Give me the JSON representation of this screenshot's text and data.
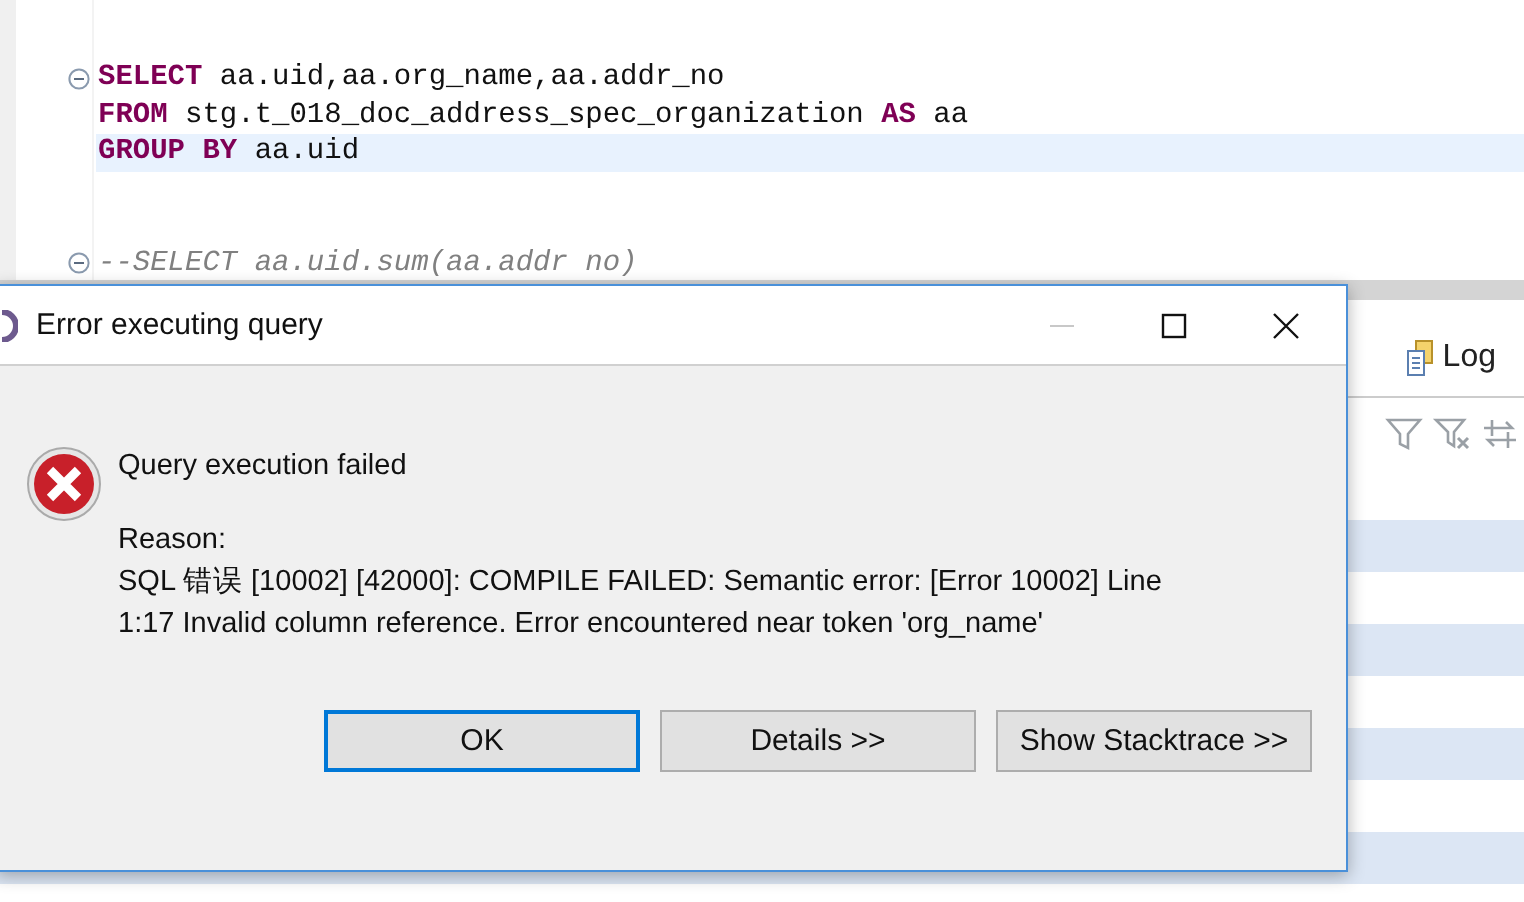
{
  "editor": {
    "lines": [
      {
        "fold": true,
        "highlighted": false,
        "tokens": [
          {
            "kind": "keyword",
            "text": "SELECT"
          },
          {
            "kind": "plain",
            "text": " aa.uid,aa.org_name,aa.addr_no"
          }
        ]
      },
      {
        "fold": false,
        "highlighted": false,
        "tokens": [
          {
            "kind": "keyword",
            "text": "FROM"
          },
          {
            "kind": "plain",
            "text": " stg.t_018_doc_address_spec_organization "
          },
          {
            "kind": "keyword",
            "text": "AS"
          },
          {
            "kind": "plain",
            "text": " aa"
          }
        ]
      },
      {
        "fold": false,
        "highlighted": true,
        "tokens": [
          {
            "kind": "keyword",
            "text": "GROUP BY"
          },
          {
            "kind": "plain",
            "text": " aa.uid"
          }
        ]
      },
      {
        "fold": true,
        "highlighted": false,
        "tokens": [
          {
            "kind": "comment",
            "text": "--SELECT aa.uid.sum(aa.addr no)"
          }
        ]
      }
    ]
  },
  "results": {
    "tab": {
      "label": "Log"
    }
  },
  "dialog": {
    "title": "Error executing query",
    "minimize_disabled": true,
    "heading": "Query execution failed",
    "reason_label": "Reason:",
    "message": "SQL 错误 [10002] [42000]: COMPILE FAILED: Semantic error: [Error 10002] Line 1:17 Invalid column reference. Error encountered near token 'org_name'",
    "buttons": [
      {
        "label": "OK",
        "default": true
      },
      {
        "label": "Details >>",
        "default": false
      },
      {
        "label": "Show Stacktrace >>",
        "default": false
      }
    ]
  }
}
